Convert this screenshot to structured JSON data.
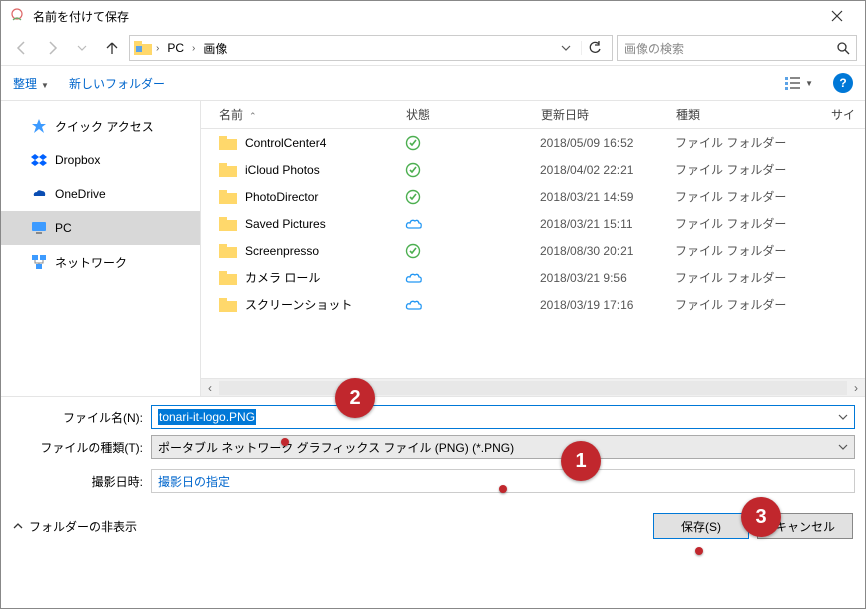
{
  "window": {
    "title": "名前を付けて保存"
  },
  "nav": {
    "path_segs": [
      "PC",
      "画像"
    ],
    "search_placeholder": "画像の検索"
  },
  "toolbar": {
    "organize": "整理",
    "newfolder": "新しいフォルダー"
  },
  "sidebar": {
    "items": [
      {
        "label": "クイック アクセス",
        "icon": "quick"
      },
      {
        "label": "Dropbox",
        "icon": "dropbox"
      },
      {
        "label": "OneDrive",
        "icon": "onedrive"
      },
      {
        "label": "PC",
        "icon": "pc"
      },
      {
        "label": "ネットワーク",
        "icon": "network"
      }
    ]
  },
  "columns": {
    "name": "名前",
    "status": "状態",
    "date": "更新日時",
    "kind": "種類",
    "size": "サイ"
  },
  "files": [
    {
      "name": "ControlCenter4",
      "status": "check",
      "date": "2018/05/09 16:52",
      "kind": "ファイル フォルダー"
    },
    {
      "name": "iCloud Photos",
      "status": "check",
      "date": "2018/04/02 22:21",
      "kind": "ファイル フォルダー"
    },
    {
      "name": "PhotoDirector",
      "status": "check",
      "date": "2018/03/21 14:59",
      "kind": "ファイル フォルダー"
    },
    {
      "name": "Saved Pictures",
      "status": "cloud",
      "date": "2018/03/21 15:11",
      "kind": "ファイル フォルダー"
    },
    {
      "name": "Screenpresso",
      "status": "check",
      "date": "2018/08/30 20:21",
      "kind": "ファイル フォルダー"
    },
    {
      "name": "カメラ ロール",
      "status": "cloud",
      "date": "2018/03/21 9:56",
      "kind": "ファイル フォルダー"
    },
    {
      "name": "スクリーンショット",
      "status": "cloud",
      "date": "2018/03/19 17:16",
      "kind": "ファイル フォルダー"
    }
  ],
  "form": {
    "filename_label": "ファイル名(N):",
    "filename_value": "tonari-it-logo.PNG",
    "filetype_label": "ファイルの種類(T):",
    "filetype_value": "ポータブル ネットワーク グラフィックス ファイル (PNG) (*.PNG)",
    "date_label": "撮影日時:",
    "date_value": "撮影日の指定"
  },
  "footer": {
    "hide": "フォルダーの非表示",
    "save": "保存(S)",
    "cancel": "キャンセル"
  },
  "annotations": {
    "b1": "1",
    "b2": "2",
    "b3": "3"
  }
}
